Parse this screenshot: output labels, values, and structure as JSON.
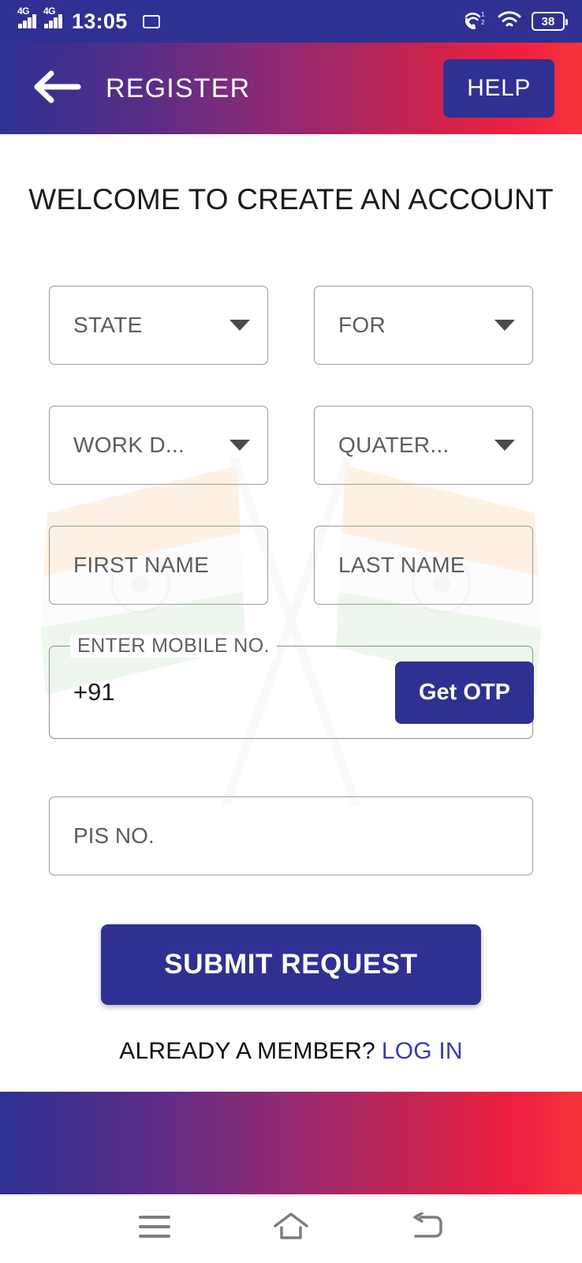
{
  "status_bar": {
    "network_label_1": "4G",
    "network_label_2": "4G",
    "time": "13:05",
    "battery_level": "38",
    "icons": [
      "signal-4g-icon",
      "signal-4g-icon",
      "cast-icon",
      "call-wifi-icon",
      "wifi-icon",
      "battery-icon"
    ]
  },
  "header": {
    "title": "REGISTER",
    "help_label": "HELP",
    "back_icon": "arrow-left-icon",
    "gradient_start": "#2e3192",
    "gradient_end": "#f8333c"
  },
  "main": {
    "welcome_heading": "WELCOME TO CREATE AN ACCOUNT",
    "fields": {
      "state": {
        "label": "STATE",
        "type": "dropdown"
      },
      "for": {
        "label": "FOR",
        "type": "dropdown"
      },
      "work_dept": {
        "label": "WORK D...",
        "type": "dropdown"
      },
      "quarter": {
        "label": "QUATER...",
        "type": "dropdown"
      },
      "first_name": {
        "label": "FIRST NAME",
        "type": "text"
      },
      "last_name": {
        "label": "LAST NAME",
        "type": "text"
      },
      "mobile": {
        "legend": "ENTER MOBILE NO.",
        "value": "+91",
        "type": "text"
      },
      "pis": {
        "label": "PIS NO.",
        "type": "text"
      }
    },
    "get_otp_label": "Get OTP",
    "submit_label": "SUBMIT REQUEST",
    "member_prompt": "ALREADY A MEMBER?",
    "login_label": "LOG IN",
    "accent_color": "#2e3192",
    "link_color": "#3b3ba8"
  },
  "nav_bar": {
    "recents_icon": "menu-icon",
    "home_icon": "home-icon",
    "back_icon": "back-arrow-icon"
  }
}
